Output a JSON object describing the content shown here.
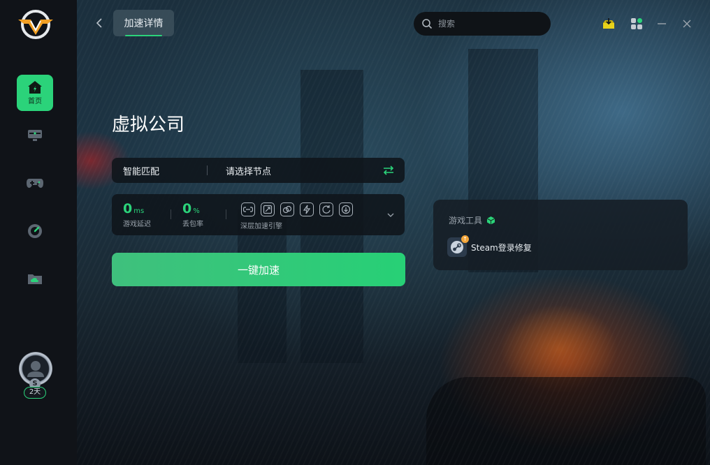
{
  "window": {
    "tab_title": "加速详情",
    "search_placeholder": "搜索"
  },
  "sidebar": {
    "items": [
      {
        "label": "首页",
        "icon": "home-icon",
        "active": true
      },
      {
        "label": "",
        "icon": "monitor-icon",
        "active": false
      },
      {
        "label": "",
        "icon": "gamepad-icon",
        "active": false
      },
      {
        "label": "",
        "icon": "speedometer-icon",
        "active": false
      },
      {
        "label": "",
        "icon": "cloud-folder-icon",
        "active": false
      }
    ],
    "user": {
      "badge": "2天",
      "level_letter": "S"
    }
  },
  "game": {
    "title": "虚拟公司"
  },
  "node": {
    "mode": "智能匹配",
    "node_placeholder": "请选择节点"
  },
  "stats": {
    "latency_value": "0",
    "latency_unit": "ms",
    "latency_label": "游戏延迟",
    "loss_value": "0",
    "loss_unit": "%",
    "loss_label": "丢包率",
    "engine_label": "深层加速引擎"
  },
  "actions": {
    "accelerate_label": "一键加速"
  },
  "tools": {
    "title": "游戏工具",
    "items": [
      {
        "label": "Steam登录修复",
        "icon": "steam-icon"
      }
    ]
  },
  "colors": {
    "accent": "#2bd37a",
    "sidebar_bg": "#101318",
    "panel_bg": "#0f141a"
  }
}
